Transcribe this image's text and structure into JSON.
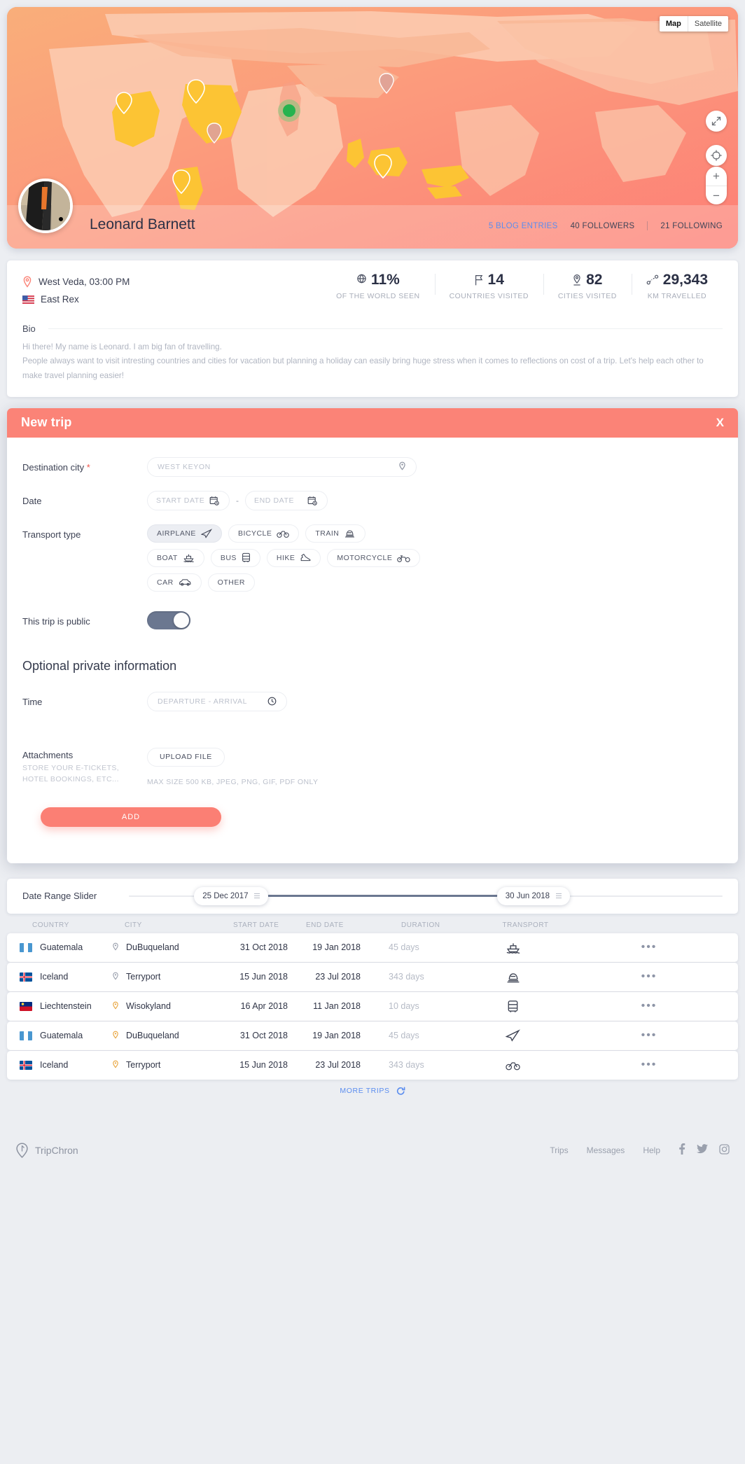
{
  "map": {
    "type_options": [
      {
        "label": "Map",
        "active": true
      },
      {
        "label": "Satellite",
        "active": false
      }
    ],
    "controls": {
      "expand": "expand-icon",
      "locate": "locate-icon",
      "zoom_in": "+",
      "zoom_out": "−"
    }
  },
  "profile": {
    "name": "Leonard Barnett",
    "avatar": "user-avatar",
    "links": [
      {
        "label": "5 BLOG ENTRIES",
        "accent": true
      },
      {
        "label": "40 FOLLOWERS",
        "accent": false
      },
      {
        "label": "21 FOLLOWING",
        "accent": false
      }
    ]
  },
  "info": {
    "location": "West Veda, 03:00 PM",
    "country": "East Rex",
    "stats": [
      {
        "value": "11%",
        "label": "OF THE WORLD SEEN",
        "icon": "globe-icon"
      },
      {
        "value": "14",
        "label": "COUNTRIES VISITED",
        "icon": "flag-icon"
      },
      {
        "value": "82",
        "label": "CITIES VISITED",
        "icon": "city-pin-icon"
      },
      {
        "value": "29,343",
        "label": "KM TRAVELLED",
        "icon": "route-icon"
      }
    ],
    "bio_label": "Bio",
    "bio_text_line1": "Hi there! My name is Leonard. I am big fan of travelling.",
    "bio_text_line2": "People always want to visit intresting countries and cities for vacation but planning a holiday can easily bring huge stress when it comes to reflections on cost of a trip. Let's help each other to make travel planning easier!"
  },
  "modal": {
    "title": "New trip",
    "close_label": "X",
    "destination": {
      "label": "Destination city",
      "required_mark": "*",
      "placeholder": "WEST KEYON",
      "value": ""
    },
    "date": {
      "label": "Date",
      "start_placeholder": "START DATE",
      "end_placeholder": "END DATE",
      "separator": "-"
    },
    "transport": {
      "label": "Transport type",
      "options": [
        {
          "label": "AIRPLANE",
          "icon": "airplane-icon",
          "selected": true
        },
        {
          "label": "BICYCLE",
          "icon": "bicycle-icon",
          "selected": false
        },
        {
          "label": "TRAIN",
          "icon": "train-icon",
          "selected": false
        },
        {
          "label": "BOAT",
          "icon": "boat-icon",
          "selected": false
        },
        {
          "label": "BUS",
          "icon": "bus-icon",
          "selected": false
        },
        {
          "label": "HIKE",
          "icon": "hike-icon",
          "selected": false
        },
        {
          "label": "MOTORCYCLE",
          "icon": "motorcycle-icon",
          "selected": false
        },
        {
          "label": "CAR",
          "icon": "car-icon",
          "selected": false
        },
        {
          "label": "OTHER",
          "icon": "",
          "selected": false
        }
      ]
    },
    "public_toggle": {
      "label": "This trip is public",
      "on": true
    },
    "optional_section_title": "Optional private information",
    "time": {
      "label": "Time",
      "placeholder": "DEPARTURE - ARRIVAL",
      "icon": "clock-icon"
    },
    "attachments": {
      "label": "Attachments",
      "sublabel": "STORE YOUR E-TICKETS, HOTEL BOOKINGS, ETC...",
      "upload_button": "UPLOAD FILE",
      "hint": "MAX SIZE 500 KB, JPEG, PNG, GIF, PDF ONLY"
    },
    "add_button": "ADD"
  },
  "slider": {
    "label": "Date Range Slider",
    "start": "25 Dec 2017",
    "end": "30 Jun 2018"
  },
  "table": {
    "columns": [
      "COUNTRY",
      "CITY",
      "START DATE",
      "END DATE",
      "DURATION",
      "TRANSPORT"
    ],
    "rows": [
      {
        "country": "Guatemala",
        "flag": "gt",
        "city": "DuBuqueland",
        "start": "31 Oct 2018",
        "end": "19 Jan 2018",
        "duration": "45 days",
        "transport": "boat-icon",
        "more": "•••"
      },
      {
        "country": "Iceland",
        "flag": "is",
        "city": "Terryport",
        "start": "15 Jun 2018",
        "end": "23 Jul 2018",
        "duration": "343 days",
        "transport": "train-icon",
        "more": "•••"
      },
      {
        "country": "Liechtenstein",
        "flag": "li",
        "city": "Wisokyland",
        "start": "16 Apr 2018",
        "end": "11 Jan 2018",
        "duration": "10 days",
        "transport": "bus-icon",
        "more": "•••"
      },
      {
        "country": "Guatemala",
        "flag": "gt",
        "city": "DuBuqueland",
        "start": "31 Oct 2018",
        "end": "19 Jan 2018",
        "duration": "45 days",
        "transport": "airplane-icon",
        "more": "•••"
      },
      {
        "country": "Iceland",
        "flag": "is",
        "city": "Terryport",
        "start": "15 Jun 2018",
        "end": "23 Jul 2018",
        "duration": "343 days",
        "transport": "bicycle-icon",
        "more": "•••"
      }
    ],
    "more_trips": "MORE TRIPS"
  },
  "footer": {
    "brand": "TripChron",
    "links": [
      "Trips",
      "Messages",
      "Help"
    ],
    "social": [
      "facebook-icon",
      "twitter-icon",
      "instagram-icon"
    ]
  },
  "colors": {
    "accent_coral": "#fb8377",
    "accent_blue": "#5b8def",
    "slate": "#6b7790",
    "pin_yellow": "#fcc434",
    "pin_green": "#26b34f"
  }
}
